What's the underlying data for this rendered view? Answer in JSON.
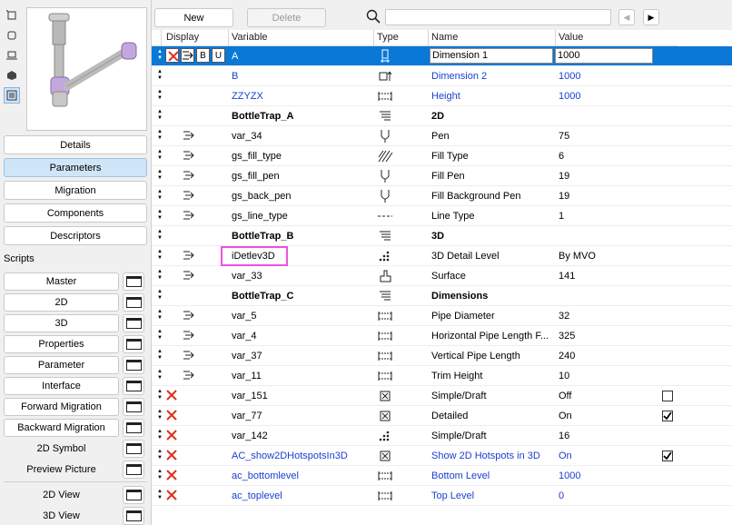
{
  "left": {
    "mini_icons": [
      "cube-outline-icon",
      "square-icon",
      "floorplan-icon",
      "cube-3d-icon",
      "list-view-icon"
    ],
    "nav_buttons": [
      {
        "label": "Details",
        "active": false
      },
      {
        "label": "Parameters",
        "active": true
      },
      {
        "label": "Migration",
        "active": false
      },
      {
        "label": "Components",
        "active": false
      },
      {
        "label": "Descriptors",
        "active": false
      }
    ],
    "scripts_label": "Scripts",
    "scripts": [
      "Master",
      "2D",
      "3D",
      "Properties",
      "Parameter",
      "Interface",
      "Forward Migration",
      "Backward Migration"
    ],
    "extras": [
      "2D Symbol",
      "Preview Picture"
    ],
    "views": [
      "2D View",
      "3D View"
    ]
  },
  "toolbar": {
    "new_label": "New",
    "delete_label": "Delete",
    "search_value": ""
  },
  "columns": {
    "display": "Display",
    "variable": "Variable",
    "type": "Type",
    "name": "Name",
    "value": "Value"
  },
  "rows": [
    {
      "variable": "A",
      "name": "Dimension 1",
      "value": "1000",
      "type": "length-vertical-icon",
      "selected": true,
      "tools": [
        "✕",
        "⇶",
        "B",
        "U"
      ]
    },
    {
      "variable": "B",
      "name": "Dimension 2",
      "value": "1000",
      "type": "length-horizontal-icon",
      "blue": true
    },
    {
      "variable": "ZZYZX",
      "name": "Height",
      "value": "1000",
      "type": "length-icon",
      "blue": true
    },
    {
      "variable": "BottleTrap_A",
      "name": "2D",
      "value": "",
      "type": "title-icon",
      "bold": true
    },
    {
      "variable": "var_34",
      "name": "Pen",
      "value": "75",
      "type": "pen-icon",
      "indent": true
    },
    {
      "variable": "gs_fill_type",
      "name": "Fill Type",
      "value": "6",
      "type": "fill-icon",
      "indent": true
    },
    {
      "variable": "gs_fill_pen",
      "name": "Fill Pen",
      "value": "19",
      "type": "pen-icon",
      "indent": true
    },
    {
      "variable": "gs_back_pen",
      "name": "Fill Background Pen",
      "value": "19",
      "type": "pen-icon",
      "indent": true
    },
    {
      "variable": "gs_line_type",
      "name": "Line Type",
      "value": "1",
      "type": "line-type-icon",
      "indent": true
    },
    {
      "variable": "BottleTrap_B",
      "name": "3D",
      "value": "",
      "type": "title-icon",
      "bold": true
    },
    {
      "variable": "iDetlev3D",
      "name": "3D Detail Level",
      "value": "By MVO",
      "type": "integer-icon",
      "indent": true,
      "highlight": true
    },
    {
      "variable": "var_33",
      "name": "Surface",
      "value": "141",
      "type": "material-icon",
      "indent": true
    },
    {
      "variable": "BottleTrap_C",
      "name": "Dimensions",
      "value": "",
      "type": "title-icon",
      "bold": true
    },
    {
      "variable": "var_5",
      "name": "Pipe Diameter",
      "value": "32",
      "type": "length-icon",
      "indent": true
    },
    {
      "variable": "var_4",
      "name": "Horizontal Pipe Length F...",
      "value": "325",
      "type": "length-icon",
      "indent": true
    },
    {
      "variable": "var_37",
      "name": "Vertical Pipe Length",
      "value": "240",
      "type": "length-icon",
      "indent": true
    },
    {
      "variable": "var_11",
      "name": "Trim Height",
      "value": "10",
      "type": "length-icon",
      "indent": true
    },
    {
      "variable": "var_151",
      "name": "Simple/Draft",
      "value": "Off",
      "type": "boolean-icon",
      "hidden": true,
      "checkbox": "unchecked"
    },
    {
      "variable": "var_77",
      "name": "Detailed",
      "value": "On",
      "type": "boolean-icon",
      "hidden": true,
      "checkbox": "checked"
    },
    {
      "variable": "var_142",
      "name": "Simple/Draft",
      "value": "16",
      "type": "integer-icon",
      "hidden": true
    },
    {
      "variable": "AC_show2DHotspotsIn3D",
      "name": "Show 2D Hotspots in 3D",
      "value": "On",
      "type": "boolean-icon",
      "hidden": true,
      "blue": true,
      "checkbox": "checked"
    },
    {
      "variable": "ac_bottomlevel",
      "name": "Bottom Level",
      "value": "1000",
      "type": "length-icon",
      "hidden": true,
      "blue": true
    },
    {
      "variable": "ac_toplevel",
      "name": "Top Level",
      "value": "0",
      "type": "length-icon",
      "hidden": true,
      "blue": true
    }
  ]
}
